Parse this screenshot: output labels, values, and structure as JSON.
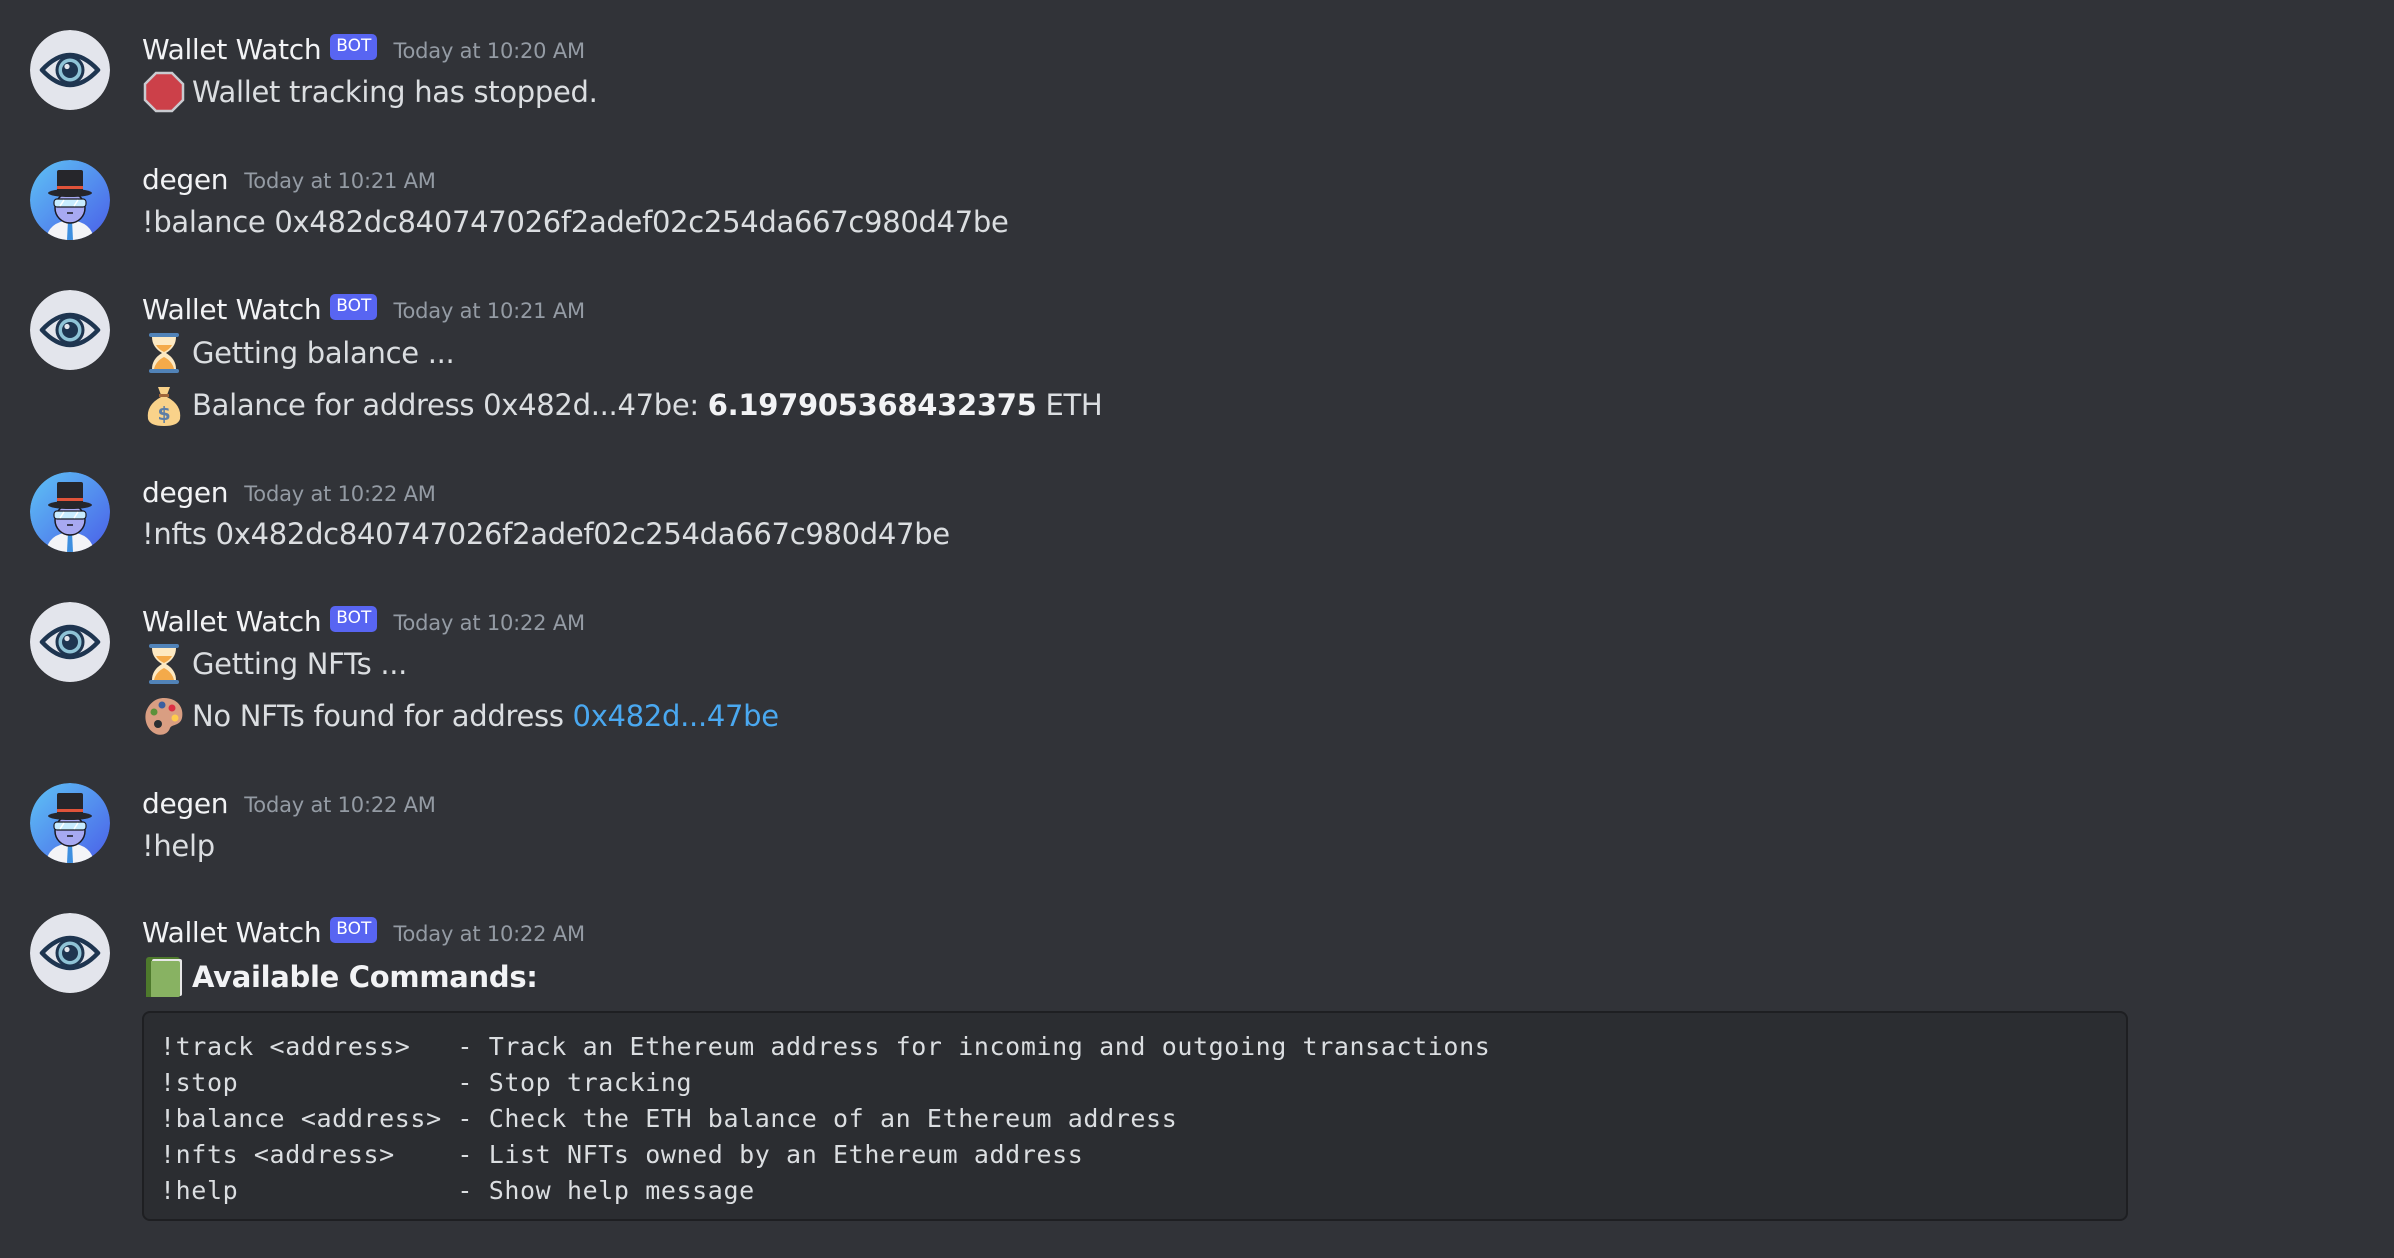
{
  "colors": {
    "background": "#313338",
    "bot_badge": "#5865f2",
    "link": "#4aa8f0",
    "code_background": "#2b2d31"
  },
  "messages": [
    {
      "author": "Wallet Watch",
      "bot": true,
      "bot_label": "BOT",
      "timestamp": "Today at 10:20 AM",
      "avatar_icon": "eye-icon",
      "lines": [
        {
          "emoji": "stop-sign-icon",
          "text": "Wallet tracking has stopped."
        }
      ]
    },
    {
      "author": "degen",
      "bot": false,
      "timestamp": "Today at 10:21 AM",
      "avatar_icon": "top-hat-character-icon",
      "lines": [
        {
          "text": "!balance 0x482dc840747026f2adef02c254da667c980d47be"
        }
      ]
    },
    {
      "author": "Wallet Watch",
      "bot": true,
      "bot_label": "BOT",
      "timestamp": "Today at 10:21 AM",
      "avatar_icon": "eye-icon",
      "lines": [
        {
          "emoji": "hourglass-icon",
          "text": "Getting balance ..."
        },
        {
          "emoji": "money-bag-icon",
          "prefix": "Balance for address 0x482d...47be: ",
          "bold": "6.197905368432375",
          "suffix": " ETH"
        }
      ]
    },
    {
      "author": "degen",
      "bot": false,
      "timestamp": "Today at 10:22 AM",
      "avatar_icon": "top-hat-character-icon",
      "lines": [
        {
          "text": "!nfts 0x482dc840747026f2adef02c254da667c980d47be"
        }
      ]
    },
    {
      "author": "Wallet Watch",
      "bot": true,
      "bot_label": "BOT",
      "timestamp": "Today at 10:22 AM",
      "avatar_icon": "eye-icon",
      "lines": [
        {
          "emoji": "hourglass-icon",
          "text": "Getting NFTs ..."
        },
        {
          "emoji": "artist-palette-icon",
          "prefix": "No NFTs found for address ",
          "link": "0x482d...47be"
        }
      ]
    },
    {
      "author": "degen",
      "bot": false,
      "timestamp": "Today at 10:22 AM",
      "avatar_icon": "top-hat-character-icon",
      "lines": [
        {
          "text": "!help"
        }
      ]
    },
    {
      "author": "Wallet Watch",
      "bot": true,
      "bot_label": "BOT",
      "timestamp": "Today at 10:22 AM",
      "avatar_icon": "eye-icon",
      "lines": [
        {
          "emoji": "green-book-icon",
          "bold": "Available Commands:"
        }
      ],
      "code_block": [
        {
          "command": "!track <address>  ",
          "description": " - Track an Ethereum address for incoming and outgoing transactions"
        },
        {
          "command": "!stop             ",
          "description": " - Stop tracking"
        },
        {
          "command": "!balance <address>",
          "description": " - Check the ETH balance of an Ethereum address"
        },
        {
          "command": "!nfts <address>   ",
          "description": " - List NFTs owned by an Ethereum address"
        },
        {
          "command": "!help             ",
          "description": " - Show help message"
        }
      ]
    }
  ]
}
